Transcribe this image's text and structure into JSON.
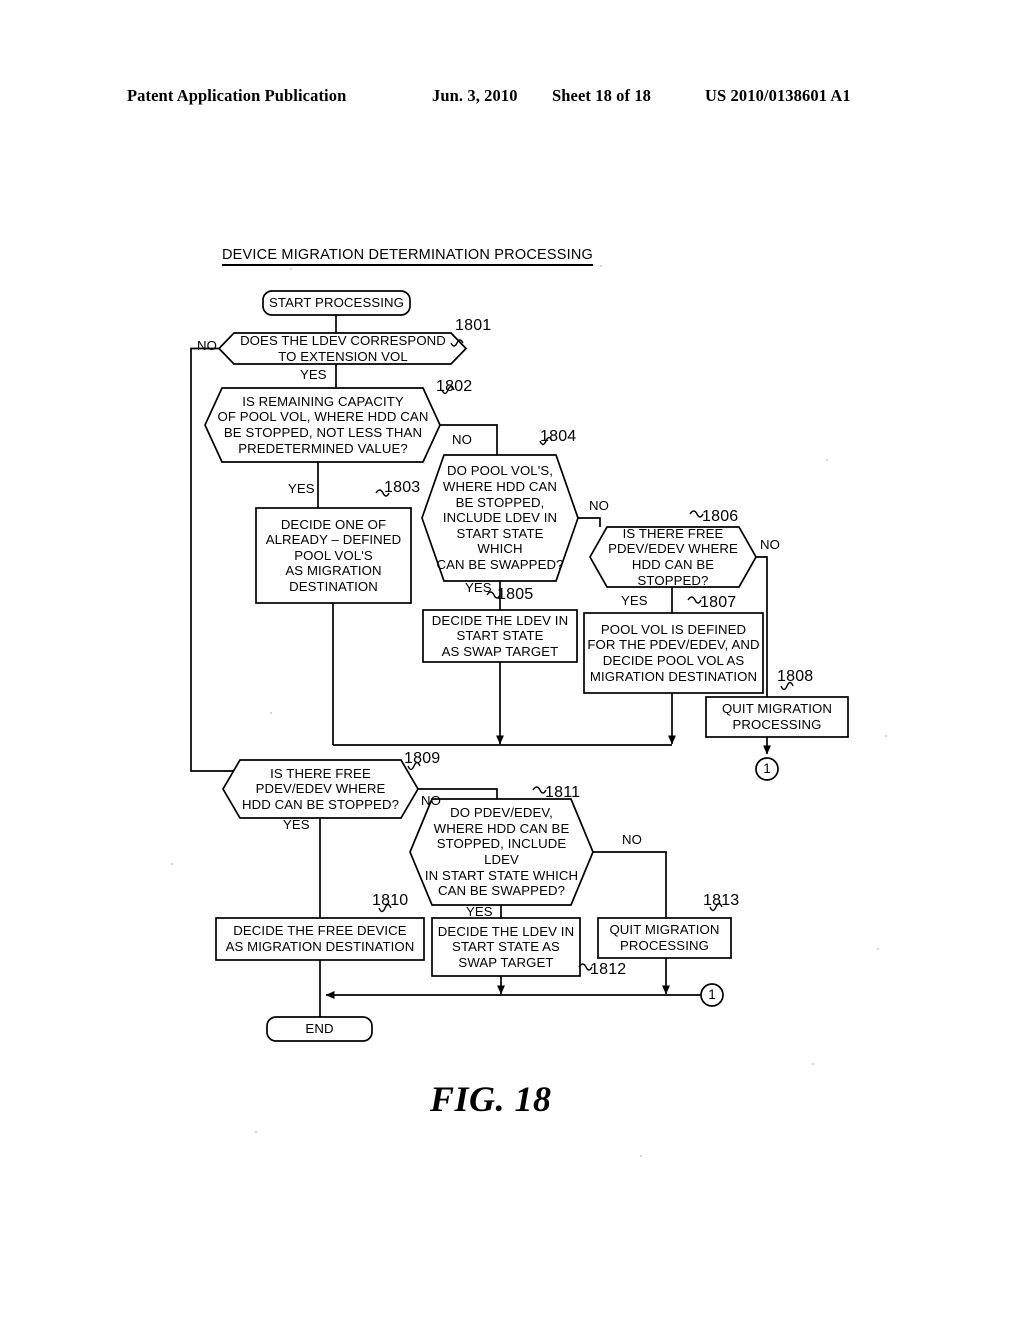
{
  "header": {
    "publication": "Patent Application Publication",
    "date": "Jun. 3, 2010",
    "sheet": "Sheet 18 of 18",
    "number": "US 2010/0138601 A1"
  },
  "figure": {
    "title": "DEVICE MIGRATION DETERMINATION PROCESSING",
    "number": "FIG. 18"
  },
  "nodes": {
    "start": {
      "label": "START PROCESSING",
      "shape": "terminator"
    },
    "end": {
      "label": "END",
      "shape": "terminator"
    },
    "d1801": {
      "ref": "1801",
      "label": "DOES THE LDEV CORRESPOND\nTO EXTENSION VOL",
      "shape": "decision"
    },
    "d1802": {
      "ref": "1802",
      "label": "IS REMAINING CAPACITY\nOF POOL VOL, WHERE HDD CAN\nBE STOPPED, NOT LESS THAN\nPREDETERMINED VALUE?",
      "shape": "decision"
    },
    "p1803": {
      "ref": "1803",
      "label": "DECIDE ONE OF\nALREADY – DEFINED\nPOOL VOL'S\nAS MIGRATION\nDESTINATION",
      "shape": "process"
    },
    "d1804": {
      "ref": "1804",
      "label": "DO POOL VOL'S,\nWHERE HDD CAN\nBE STOPPED,\nINCLUDE LDEV IN\nSTART STATE WHICH\nCAN BE SWAPPED?",
      "shape": "decision"
    },
    "p1805": {
      "ref": "1805",
      "label": "DECIDE THE LDEV IN\nSTART STATE\nAS SWAP TARGET",
      "shape": "process"
    },
    "d1806": {
      "ref": "1806",
      "label": "IS THERE FREE\nPDEV/EDEV WHERE\nHDD CAN BE STOPPED?",
      "shape": "decision"
    },
    "p1807": {
      "ref": "1807",
      "label": "POOL VOL IS DEFINED\nFOR THE PDEV/EDEV, AND\nDECIDE POOL VOL AS\nMIGRATION DESTINATION",
      "shape": "process"
    },
    "p1808": {
      "ref": "1808",
      "label": "QUIT MIGRATION\nPROCESSING",
      "shape": "process"
    },
    "d1809": {
      "ref": "1809",
      "label": "IS THERE FREE\nPDEV/EDEV WHERE\nHDD CAN BE STOPPED?",
      "shape": "decision"
    },
    "p1810": {
      "ref": "1810",
      "label": "DECIDE THE FREE DEVICE\nAS MIGRATION DESTINATION",
      "shape": "process"
    },
    "d1811": {
      "ref": "1811",
      "label": "DO PDEV/EDEV,\nWHERE HDD CAN BE\nSTOPPED, INCLUDE LDEV\nIN START STATE WHICH\nCAN BE SWAPPED?",
      "shape": "decision"
    },
    "p1812": {
      "ref": "1812",
      "label": "DECIDE THE LDEV IN\nSTART STATE AS\nSWAP TARGET",
      "shape": "process"
    },
    "p1813": {
      "ref": "1813",
      "label": "QUIT MIGRATION\nPROCESSING",
      "shape": "process"
    }
  },
  "edge_labels": {
    "no_1801": "NO",
    "yes_1801": "YES",
    "yes_1802": "YES",
    "no_1802": "NO",
    "yes_1804": "YES",
    "no_1804": "NO",
    "yes_1806": "YES",
    "no_1806": "NO",
    "yes_1809": "YES",
    "no_1809": "NO",
    "yes_1811": "YES",
    "no_1811": "NO"
  },
  "connectors": {
    "circle_top": "1",
    "circle_bottom": "1"
  },
  "colors": {
    "ink": "#000000",
    "paper": "#ffffff"
  }
}
